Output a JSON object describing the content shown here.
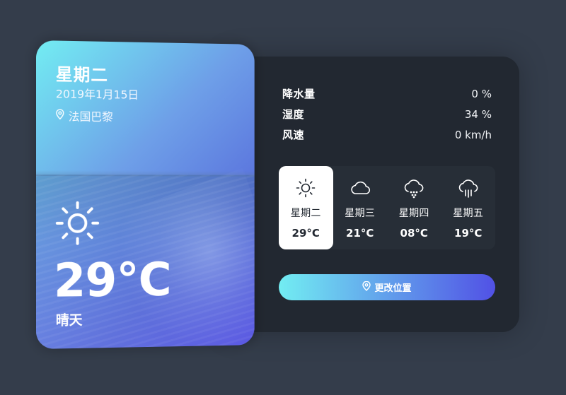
{
  "weather": {
    "day": "星期二",
    "date": "2019年1月15日",
    "location": "法国巴黎",
    "temperature": "29°C",
    "description": "晴天",
    "icon": "sun-icon"
  },
  "stats": [
    {
      "label": "降水量",
      "value": "0 %"
    },
    {
      "label": "湿度",
      "value": "34 %"
    },
    {
      "label": "风速",
      "value": "0 km/h"
    }
  ],
  "week": [
    {
      "day": "星期二",
      "temp": "29°C",
      "icon": "sun-icon",
      "active": true
    },
    {
      "day": "星期三",
      "temp": "21°C",
      "icon": "cloud-icon",
      "active": false
    },
    {
      "day": "星期四",
      "temp": "08°C",
      "icon": "cloud-snow-icon",
      "active": false
    },
    {
      "day": "星期五",
      "temp": "19°C",
      "icon": "cloud-rain-icon",
      "active": false
    }
  ],
  "button": {
    "label": "更改位置",
    "icon": "map-pin-icon"
  },
  "colors": {
    "background": "#343d4b",
    "card": "#222831",
    "gradient_start": "#72edf2",
    "gradient_end": "#5151e5"
  }
}
